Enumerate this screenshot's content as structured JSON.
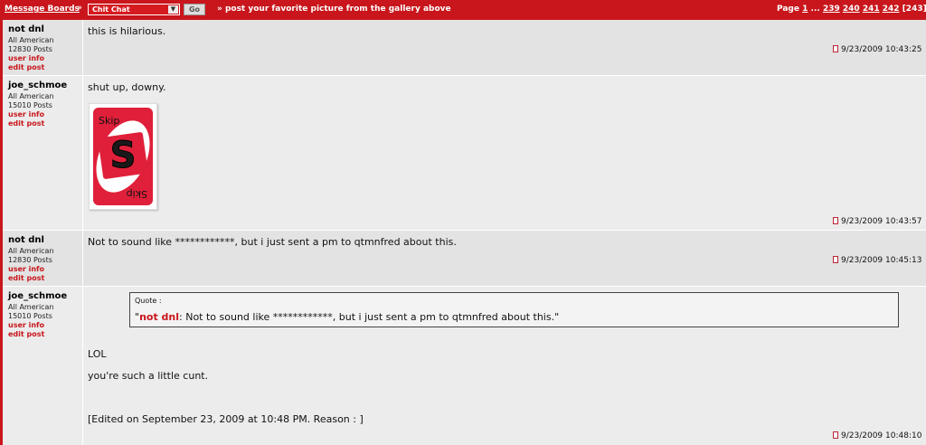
{
  "header": {
    "breadcrumb_label": "Message Boards",
    "separator": "»",
    "forum_select_value": "Chit Chat",
    "go_label": "Go",
    "thread_title": "» post your favorite picture from the gallery above",
    "pager": {
      "prefix": "Page",
      "first": "1",
      "ellipsis": "...",
      "pages": [
        "239",
        "240",
        "241",
        "242"
      ],
      "total": "[243],"
    }
  },
  "posts": [
    {
      "author": "not dnl",
      "rank": "All American",
      "post_count": "12830 Posts",
      "user_info_label": "user info",
      "edit_post_label": "edit post",
      "text": "this is hilarious.",
      "timestamp": "9/23/2009 10:43:25"
    },
    {
      "author": "joe_schmoe",
      "rank": "All American",
      "post_count": "15010 Posts",
      "user_info_label": "user info",
      "edit_post_label": "edit post",
      "text": "shut up, downy.",
      "image": {
        "top_text": "Skip",
        "bottom_text": "Skip",
        "letter": "S"
      },
      "timestamp": "9/23/2009 10:43:57"
    },
    {
      "author": "not dnl",
      "rank": "All American",
      "post_count": "12830 Posts",
      "user_info_label": "user info",
      "edit_post_label": "edit post",
      "text": "Not to sound like ************, but i just sent a pm to qtmnfred about this.",
      "timestamp": "9/23/2009 10:45:13"
    },
    {
      "author": "joe_schmoe",
      "rank": "All American",
      "post_count": "15010 Posts",
      "user_info_label": "user info",
      "edit_post_label": "edit post",
      "quote": {
        "label": "Quote :",
        "open": "\"",
        "author": "not dnl",
        "text": ": Not to sound like ************, but i just sent a pm to qtmnfred about this.\""
      },
      "lines": [
        "LOL",
        "you're such a little cunt."
      ],
      "edited": "[Edited on September 23, 2009 at 10:48 PM. Reason : ]",
      "timestamp": "9/23/2009 10:48:10"
    }
  ],
  "colors": {
    "brand_red": "#c8161c",
    "post_bg_a": "#e3e3e3",
    "post_bg_b": "#ececec"
  }
}
